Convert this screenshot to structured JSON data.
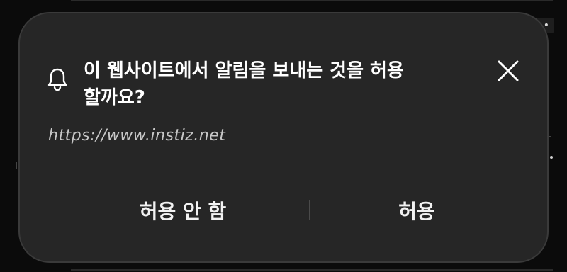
{
  "background": {
    "more_glyph": "•••"
  },
  "dialog": {
    "title": "이 웹사이트에서 알림을 보내는 것을 허용할까요?",
    "url": "https://www.instiz.net",
    "icon": "bell-icon",
    "close_icon": "close-icon",
    "deny_label": "허용 안 함",
    "allow_label": "허용"
  },
  "colors": {
    "background": "#0b0b0b",
    "dialog": "#262626",
    "dialog_border": "#3a3a3a",
    "text": "#ffffff",
    "url_text": "#c8c8c8"
  }
}
